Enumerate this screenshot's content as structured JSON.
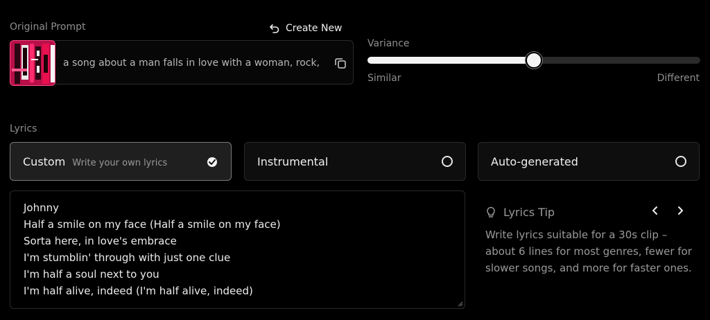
{
  "prompt_section": {
    "label": "Original Prompt",
    "create_new_label": "Create New",
    "prompt_text": "a song about a man falls in love with a woman, rock,"
  },
  "variance": {
    "label": "Variance",
    "min_label": "Similar",
    "max_label": "Different",
    "value_fraction": 0.5
  },
  "lyrics_section": {
    "label": "Lyrics",
    "options": [
      {
        "title": "Custom",
        "subtitle": "Write your own lyrics",
        "selected": true
      },
      {
        "title": "Instrumental",
        "subtitle": "",
        "selected": false
      },
      {
        "title": "Auto-generated",
        "subtitle": "",
        "selected": false
      }
    ],
    "lines": [
      "Johnny",
      "Half a smile on my face (Half a smile on my face)",
      "Sorta here, in love's embrace",
      "I'm stumblin' through with just one clue",
      "I'm half a soul next to you",
      "I'm half alive, indeed (I'm half alive, indeed)"
    ]
  },
  "tip": {
    "title": "Lyrics Tip",
    "body": "Write lyrics suitable for a 30s clip – about 6 lines for most genres, fewer for slower songs, and more for faster ones."
  },
  "colors": {
    "background": "#000000",
    "accent_thumb": "#c4124f"
  }
}
